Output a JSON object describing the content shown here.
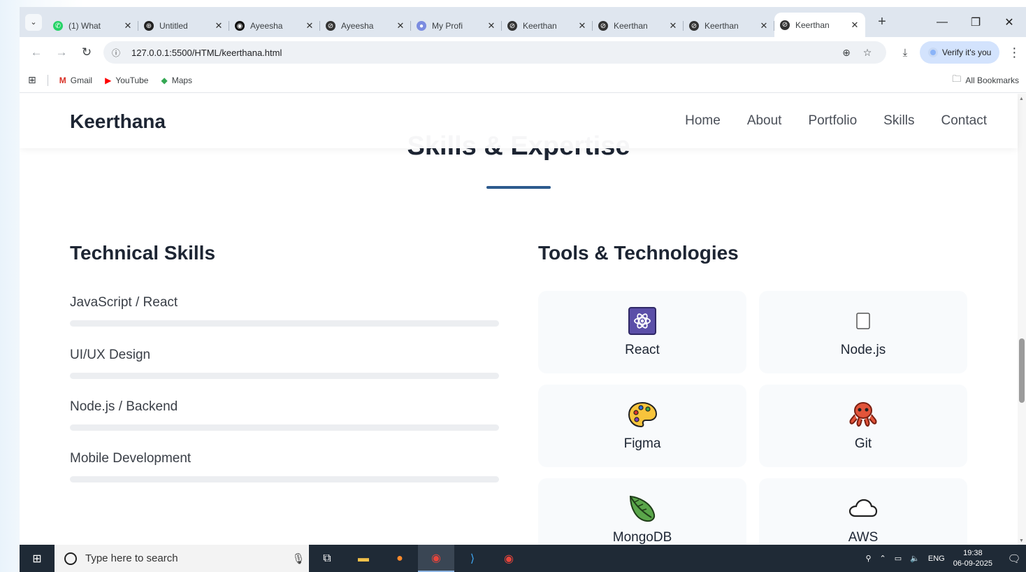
{
  "browser": {
    "tabs": [
      {
        "title": "(1) What",
        "favicon_color": "#25d366",
        "favicon": "✆"
      },
      {
        "title": "Untitled",
        "favicon_color": "#222222",
        "favicon": "⊕"
      },
      {
        "title": "Ayeesha",
        "favicon_color": "#111111",
        "favicon": "◉"
      },
      {
        "title": "Ayeesha",
        "favicon_color": "#333333",
        "favicon": "⊘"
      },
      {
        "title": "My Profi",
        "favicon_color": "#7b8ce0",
        "favicon": "●"
      },
      {
        "title": "Keerthan",
        "favicon_color": "#333333",
        "favicon": "⊘"
      },
      {
        "title": "Keerthan",
        "favicon_color": "#333333",
        "favicon": "⊘"
      },
      {
        "title": "Keerthan",
        "favicon_color": "#333333",
        "favicon": "⊘"
      },
      {
        "title": "Keerthan",
        "favicon_color": "#333333",
        "favicon": "⊘",
        "active": true
      }
    ],
    "url": "127.0.0.1:5500/HTML/keerthana.html",
    "verify_label": "Verify it's you",
    "bookmarks": [
      {
        "label": "Gmail",
        "icon": "M",
        "color": "#d93025"
      },
      {
        "label": "YouTube",
        "icon": "▶",
        "color": "#ff0000"
      },
      {
        "label": "Maps",
        "icon": "◆",
        "color": "#34a853"
      }
    ],
    "all_bookmarks": "All Bookmarks"
  },
  "site": {
    "brand": "Keerthana",
    "nav": [
      "Home",
      "About",
      "Portfolio",
      "Skills",
      "Contact"
    ],
    "section_title": "Skills & Expertise",
    "technical_heading": "Technical Skills",
    "tools_heading": "Tools & Technologies",
    "skills": [
      {
        "name": "JavaScript / React",
        "level": 0
      },
      {
        "name": "UI/UX Design",
        "level": 0
      },
      {
        "name": "Node.js / Backend",
        "level": 0
      },
      {
        "name": "Mobile Development",
        "level": 0
      }
    ],
    "tools": [
      {
        "name": "React",
        "icon": "react-icon"
      },
      {
        "name": "Node.js",
        "icon": "nodejs-icon"
      },
      {
        "name": "Figma",
        "icon": "palette-icon"
      },
      {
        "name": "Git",
        "icon": "octopus-icon"
      },
      {
        "name": "MongoDB",
        "icon": "leaf-icon"
      },
      {
        "name": "AWS",
        "icon": "cloud-icon"
      }
    ]
  },
  "taskbar": {
    "search_placeholder": "Type here to search",
    "language": "ENG",
    "time": "19:38",
    "date": "06-09-2025"
  },
  "colors": {
    "accent": "#2d5b8e",
    "text_dark": "#1d2533",
    "taskbar": "#1f2a36"
  }
}
